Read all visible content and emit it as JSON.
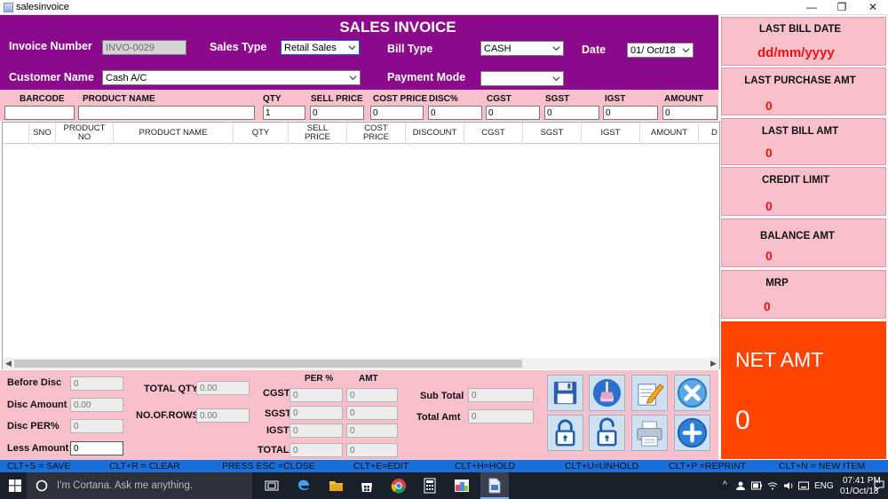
{
  "window": {
    "title": "salesinvoice"
  },
  "header": {
    "title": "SALES INVOICE",
    "invoice_number_label": "Invoice Number",
    "invoice_number_value": "INVO-0029",
    "sales_type_label": "Sales Type",
    "sales_type_value": "Retail Sales",
    "bill_type_label": "Bill Type",
    "bill_type_value": "CASH",
    "date_label": "Date",
    "date_value": "01/ Oct/18",
    "customer_name_label": "Customer Name",
    "customer_name_value": "Cash A/C",
    "payment_mode_label": "Payment Mode",
    "payment_mode_value": ""
  },
  "entry": {
    "barcode_label": "BARCODE",
    "product_name_label": "PRODUCT NAME",
    "qty_label": "QTY",
    "sell_price_label": "SELL PRICE",
    "cost_price_label": "COST PRICE",
    "disc_label": "DISC%",
    "cgst_label": "CGST",
    "sgst_label": "SGST",
    "igst_label": "IGST",
    "amount_label": "AMOUNT",
    "barcode_value": "",
    "product_name_value": "",
    "qty_value": "1",
    "sell_price_value": "0",
    "cost_price_value": "0",
    "disc_value": "0",
    "cgst_value": "0",
    "sgst_value": "0",
    "igst_value": "0",
    "amount_value": "0"
  },
  "grid": {
    "columns": [
      "SNO",
      "PRODUCT\nNO",
      "PRODUCT NAME",
      "QTY",
      "SELL\nPRICE",
      "COST\nPRICE",
      "DISCOUNT",
      "CGST",
      "SGST",
      "IGST",
      "AMOUNT",
      "D"
    ]
  },
  "totals": {
    "before_disc_label": "Before Disc",
    "before_disc_value": "0",
    "disc_amount_label": "Disc Amount",
    "disc_amount_value": "0.00",
    "disc_per_label": "Disc PER%",
    "disc_per_value": "0",
    "less_amount_label": "Less Amount",
    "less_amount_value": "0",
    "total_qty_label": "TOTAL QTY",
    "total_qty_value": "0.00",
    "no_of_rows_label": "NO.OF.ROWS",
    "no_of_rows_value": "0.00",
    "per_label": "PER %",
    "amt_label": "AMT",
    "cgst_label": "CGST",
    "sgst_label": "SGST",
    "igst_label": "IGST",
    "total_label": "TOTAL",
    "cgst_per": "0",
    "cgst_amt": "0",
    "sgst_per": "0",
    "sgst_amt": "0",
    "igst_per": "0",
    "igst_amt": "0",
    "total_per": "0",
    "total_amt_gst": "0",
    "sub_total_label": "Sub Total",
    "sub_total_value": "0",
    "total_amt_label": "Total Amt",
    "total_amt_value": "0"
  },
  "actions": {
    "icons": [
      "save-icon",
      "clear-icon",
      "edit-icon",
      "close-icon",
      "hold-icon",
      "unhold-icon",
      "reprint-icon",
      "new-item-icon"
    ]
  },
  "side": {
    "last_bill_date_label": "LAST BILL DATE",
    "last_bill_date_value": "dd/mm/yyyy",
    "last_purchase_amt_label": "LAST PURCHASE AMT",
    "last_purchase_amt_value": "0",
    "last_bill_amt_label": "LAST BILL AMT",
    "last_bill_amt_value": "0",
    "credit_limit_label": "CREDIT LIMIT",
    "credit_limit_value": "0",
    "balance_amt_label": "BALANCE AMT",
    "balance_amt_value": "0",
    "mrp_label": "MRP",
    "mrp_value": "0",
    "net_amt_label": "NET AMT",
    "net_amt_value": "0"
  },
  "shortcuts": [
    "CLT+S = SAVE",
    "CLT+R = CLEAR",
    "PRESS ESC =CLOSE",
    "CLT+E=EDIT",
    "CLT+H=HOLD",
    "CLT+U=UNHOLD",
    "CLT+P =REPRINT",
    "CLT+N = NEW ITEM"
  ],
  "taskbar": {
    "search_placeholder": "I'm Cortana. Ask me anything.",
    "language": "ENG",
    "time": "07:41 PM",
    "date": "01/Oct/18"
  },
  "colors": {
    "header_bg": "#8b0a8b",
    "panel_pink": "#f7c0cb",
    "net_amt_bg": "#ff4500",
    "shortcut_strip": "#1a6ed8",
    "value_red": "#ee1111"
  }
}
